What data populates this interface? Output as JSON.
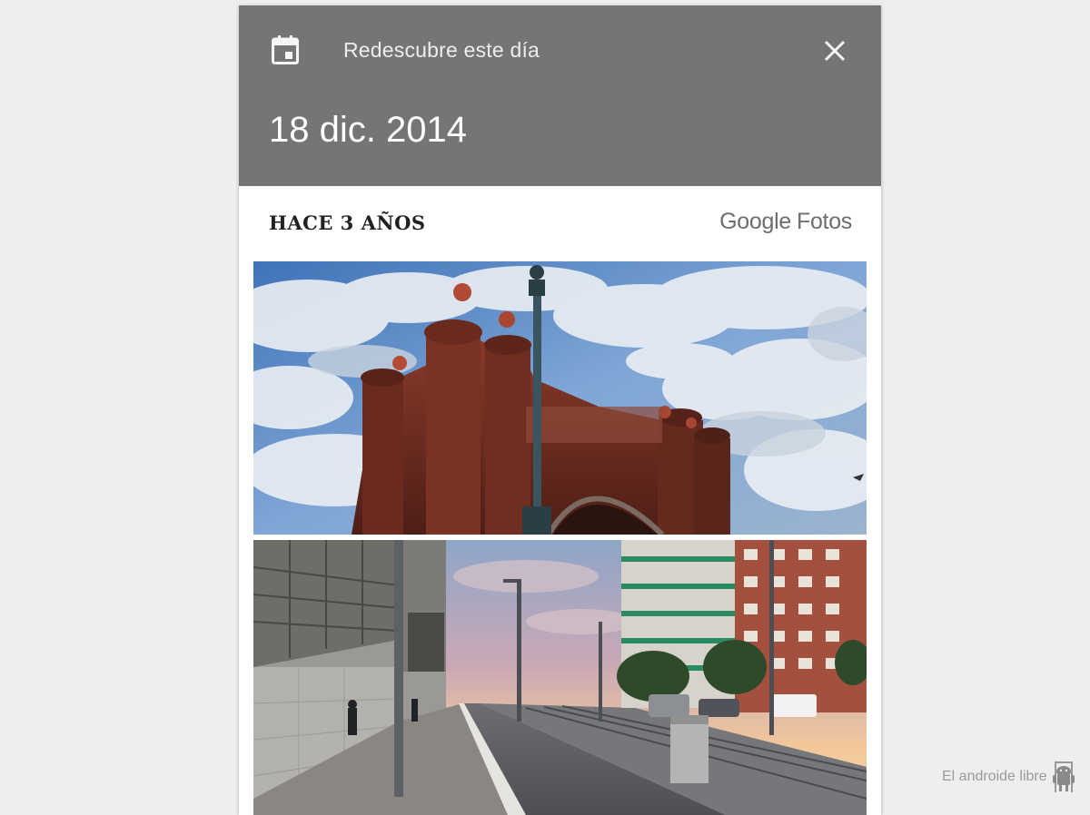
{
  "card": {
    "header": {
      "calendar_icon": "calendar-icon",
      "title": "Redescubre este día",
      "close_icon": "close-icon",
      "date": "18 dic. 2014",
      "background": "#757575"
    },
    "section": {
      "title": "HACE 3 AÑOS",
      "brand_google": "Google",
      "brand_fotos": "Fotos"
    },
    "photos": [
      {
        "subject": "arc-de-triomf-photo"
      },
      {
        "subject": "street-sunrise-photo"
      }
    ]
  },
  "watermark": {
    "text": "El androide libre"
  }
}
